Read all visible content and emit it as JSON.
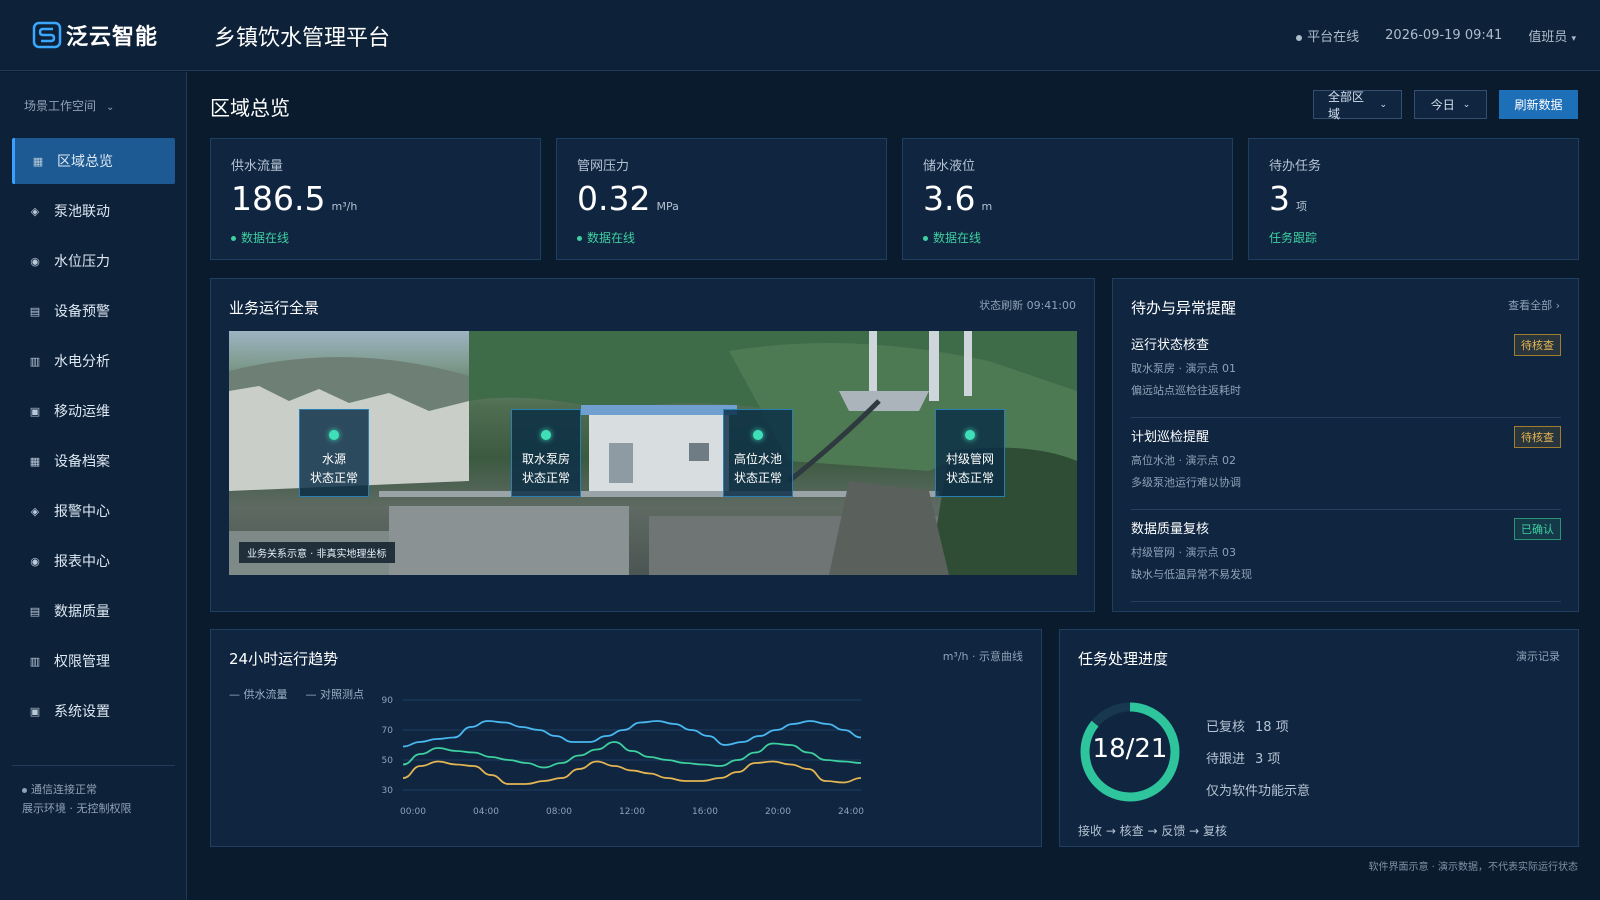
{
  "header": {
    "brand": "泛云智能",
    "app_title": "乡镇饮水管理平台",
    "status": "平台在线",
    "datetime": "2026-09-19 09:41",
    "user": "值班员"
  },
  "sidebar": {
    "workspace": "场景工作空间",
    "items": [
      {
        "label": "区域总览",
        "icon": "grid-icon",
        "active": true
      },
      {
        "label": "泵池联动",
        "icon": "diamond-icon"
      },
      {
        "label": "水位压力",
        "icon": "radio-icon"
      },
      {
        "label": "设备预警",
        "icon": "list-icon"
      },
      {
        "label": "水电分析",
        "icon": "columns-icon"
      },
      {
        "label": "移动运维",
        "icon": "square-icon"
      },
      {
        "label": "设备档案",
        "icon": "grid-icon"
      },
      {
        "label": "报警中心",
        "icon": "diamond-icon"
      },
      {
        "label": "报表中心",
        "icon": "radio-icon"
      },
      {
        "label": "数据质量",
        "icon": "list-icon"
      },
      {
        "label": "权限管理",
        "icon": "columns-icon"
      },
      {
        "label": "系统设置",
        "icon": "square-icon"
      }
    ],
    "footer_status": "通信连接正常",
    "footer_note": "展示环境 · 无控制权限"
  },
  "page": {
    "title": "区域总览",
    "filter_region": "全部区域",
    "filter_time": "今日",
    "refresh": "刷新数据"
  },
  "kpis": [
    {
      "label": "供水流量",
      "value": "186.5",
      "unit": "m³/h",
      "status": "数据在线",
      "status_dot": true
    },
    {
      "label": "管网压力",
      "value": "0.32",
      "unit": "MPa",
      "status": "数据在线",
      "status_dot": true
    },
    {
      "label": "储水液位",
      "value": "3.6",
      "unit": "m",
      "status": "数据在线",
      "status_dot": true
    },
    {
      "label": "待办任务",
      "value": "3",
      "unit": "项",
      "status": "任务跟踪",
      "status_dot": false
    }
  ],
  "overview": {
    "title": "业务运行全景",
    "refresh_time": "状态刷新 09:41:00",
    "nodes": [
      {
        "name": "水源",
        "state": "状态正常"
      },
      {
        "name": "取水泵房",
        "state": "状态正常"
      },
      {
        "name": "高位水池",
        "state": "状态正常"
      },
      {
        "name": "村级管网",
        "state": "状态正常"
      }
    ],
    "caption": "业务关系示意 · 非真实地理坐标"
  },
  "alerts": {
    "title": "待办与异常提醒",
    "view_all": "查看全部 ›",
    "items": [
      {
        "title": "运行状态核查",
        "sub": "取水泵房 · 演示点 01",
        "desc": "偏远站点巡检往返耗时",
        "badge": "待核查",
        "badge_type": "warn"
      },
      {
        "title": "计划巡检提醒",
        "sub": "高位水池 · 演示点 02",
        "desc": "多级泵池运行难以协调",
        "badge": "待核查",
        "badge_type": "warn"
      },
      {
        "title": "数据质量复核",
        "sub": "村级管网 · 演示点 03",
        "desc": "缺水与低温异常不易发现",
        "badge": "已确认",
        "badge_type": "ok"
      }
    ]
  },
  "trend": {
    "title": "24小时运行趋势",
    "unit_note": "m³/h · 示意曲线",
    "legend_a": "— 供水流量",
    "legend_b": "— 对照测点"
  },
  "chart_data": {
    "type": "line",
    "x": [
      "00:00",
      "01:00",
      "02:00",
      "03:00",
      "04:00",
      "05:00",
      "06:00",
      "07:00",
      "08:00",
      "09:00",
      "10:00",
      "11:00",
      "12:00",
      "13:00",
      "14:00",
      "15:00",
      "16:00",
      "17:00",
      "18:00",
      "19:00",
      "20:00",
      "21:00",
      "22:00",
      "23:00",
      "24:00"
    ],
    "xticks": [
      "00:00",
      "04:00",
      "08:00",
      "12:00",
      "16:00",
      "20:00",
      "24:00"
    ],
    "yticks": [
      30,
      50,
      70,
      90
    ],
    "ylim": [
      30,
      90
    ],
    "series": [
      {
        "name": "供水流量",
        "color": "#4ab8f0",
        "values": [
          59,
          62,
          64,
          65,
          72,
          76,
          75,
          72,
          70,
          66,
          62,
          62,
          66,
          70,
          75,
          76,
          74,
          70,
          66,
          60,
          62,
          66,
          70,
          74,
          76,
          74,
          70,
          65
        ]
      },
      {
        "name": "对照测点",
        "color": "#3fd0a0",
        "values": [
          47,
          54,
          58,
          56,
          55,
          52,
          50,
          48,
          45,
          48,
          53,
          57,
          62,
          56,
          52,
          50,
          48,
          47,
          46,
          50,
          55,
          61,
          60,
          55,
          50,
          49,
          48
        ]
      },
      {
        "name": "",
        "color": "#e4b553",
        "values": [
          38,
          46,
          49,
          47,
          46,
          40,
          34,
          34,
          36,
          38,
          44,
          49,
          46,
          43,
          41,
          38,
          36,
          36,
          38,
          42,
          48,
          49,
          47,
          44,
          36,
          35,
          38
        ]
      }
    ]
  },
  "progress": {
    "title": "任务处理进度",
    "meta": "演示记录",
    "ratio_text": "18/21",
    "done": 18,
    "total": 21,
    "done_label": "已复核",
    "done_value": "18 项",
    "pending_label": "待跟进",
    "pending_value": "3 项",
    "note": "仅为软件功能示意",
    "flow": "接收 → 核查 → 反馈 → 复核",
    "ring_color": "#2ec49c",
    "ring_track": "#17384f"
  },
  "footnote": "软件界面示意 · 演示数据，不代表实际运行状态"
}
